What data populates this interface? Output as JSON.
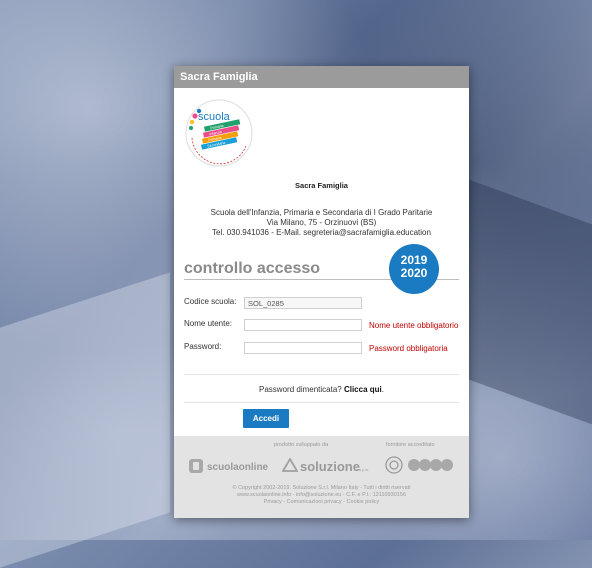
{
  "header": {
    "title": "Sacra Famiglia"
  },
  "logo": {
    "text_main": "scuola",
    "stripes": [
      "Primaria",
      "Infanzia",
      "Primaria",
      "Secondaria"
    ],
    "ring_text": "sacra famiglia education"
  },
  "school": {
    "name": "Sacra Famiglia",
    "line1": "Scuola dell'Infanzia, Primaria e Secondaria di I Grado Paritarie",
    "line2": "Via Milano, 75 - Orzinuovi (BS)",
    "line3": "Tel. 030.941036 - E-Mail. segreteria@sacrafamiglia.education"
  },
  "badge": {
    "year_top": "2019",
    "year_bottom": "2020"
  },
  "section_title": "controllo accesso",
  "form": {
    "school_code_label": "Codice scuola:",
    "school_code_value": "SOL_0285",
    "username_label": "Nome utente:",
    "username_value": "",
    "username_error": "Nome utente obbligatorio",
    "password_label": "Password:",
    "password_value": "",
    "password_error": "Password obbligatoria"
  },
  "forgot": {
    "prefix": "Password dimenticata? ",
    "link": "Clicca qui",
    "suffix": "."
  },
  "login_button": "Accedi",
  "footer": {
    "product_caption": "prodotto sviluppato da",
    "supplier_caption": "fornitore accreditato",
    "brand1": "scuolaonline",
    "brand2": "soluzione",
    "brand2_suffix": "s.p.a.",
    "copyright1": "© Copyright 2002-2019. Soluzione S.r.l. Milano Italy - Tutti i diritti riservati",
    "copyright2": "www.scuolaonline.info - info@soluzione.eu - C.F. e P.I.: 12110930156",
    "copyright3": "Privacy - Comunicazioni privacy - Cookie policy"
  },
  "colors": {
    "accent": "#1b7bc2",
    "error": "#c00000",
    "header": "#9b9b9b"
  }
}
